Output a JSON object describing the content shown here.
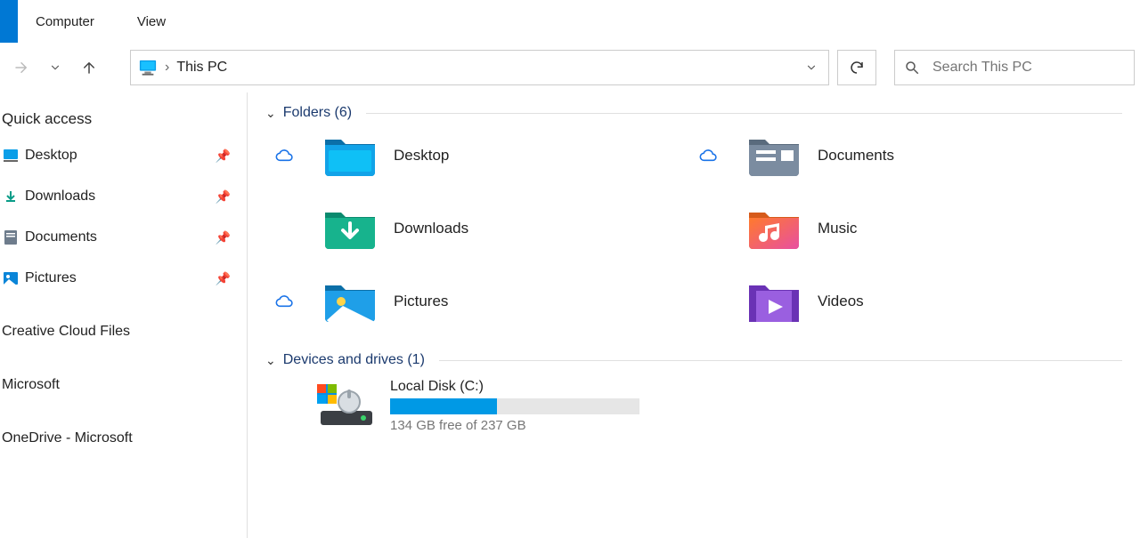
{
  "ribbon": {
    "tabs": [
      "Computer",
      "View"
    ]
  },
  "nav": {
    "breadcrumb": "This PC",
    "search_placeholder": "Search This PC"
  },
  "sidebar": {
    "title": "Quick access",
    "pinned": [
      {
        "label": "Desktop"
      },
      {
        "label": "Downloads"
      },
      {
        "label": "Documents"
      },
      {
        "label": "Pictures"
      }
    ],
    "other": [
      {
        "label": "Creative Cloud Files"
      },
      {
        "label": "Microsoft"
      },
      {
        "label": "OneDrive - Microsoft"
      }
    ]
  },
  "content": {
    "folders_header": "Folders (6)",
    "folders": [
      {
        "label": "Desktop",
        "sync": true
      },
      {
        "label": "Documents",
        "sync": true
      },
      {
        "label": "Downloads",
        "sync": false
      },
      {
        "label": "Music",
        "sync": false
      },
      {
        "label": "Pictures",
        "sync": true
      },
      {
        "label": "Videos",
        "sync": false
      }
    ],
    "drives_header": "Devices and drives (1)",
    "drive": {
      "name": "Local Disk (C:)",
      "free_text": "134 GB free of 237 GB",
      "used_percent": 43
    }
  }
}
